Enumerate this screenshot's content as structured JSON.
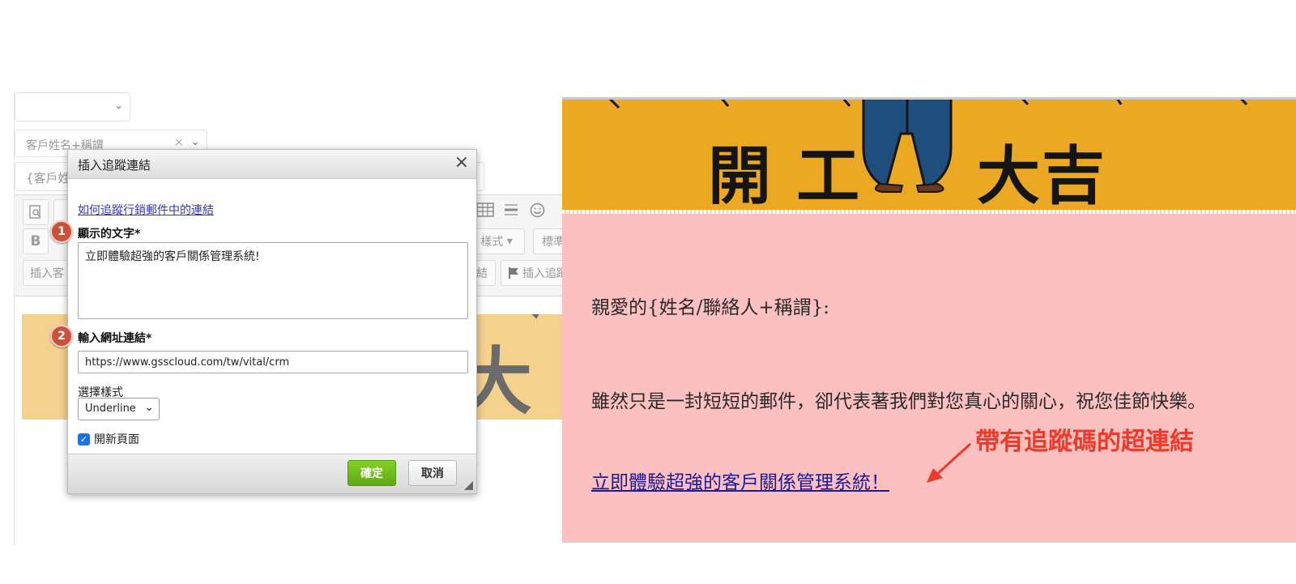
{
  "editor": {
    "salutation_select": "客戶姓名+稱謂",
    "salutation_clear": "×",
    "variable_field": "{客戶姓",
    "toolbar": {
      "style_button": "樣式",
      "format_button": "標準",
      "insert_customer_button": "插入客",
      "insert_link_button": "結",
      "insert_tracking_button": "插入追蹤"
    },
    "banner_ghost_text": "大吉"
  },
  "dialog": {
    "title": "插入追蹤連結",
    "close_label": "×",
    "help_link": "如何追蹤行銷郵件中的連結",
    "step1_badge": "1",
    "display_text_label": "顯示的文字*",
    "display_text_value": "立即體驗超強的客戶關係管理系統!",
    "step2_badge": "2",
    "url_label": "輸入網址連結*",
    "url_value": "https://www.gsscloud.com/tw/vital/crm",
    "style_label": "選擇樣式",
    "style_value": "Underline",
    "new_page_label": "開新頁面",
    "new_page_checked": true,
    "ok_button": "確定",
    "cancel_button": "取消"
  },
  "preview": {
    "banner_left": "開 工",
    "banner_right": "大吉",
    "greeting": "親愛的{姓名/聯絡人+稱謂}:",
    "body": "雖然只是一封短短的郵件，卻代表著我們對您真心的關心，祝您佳節快樂。",
    "link_text": "立即體驗超強的客戶關係管理系統！",
    "annotation": "帶有追蹤碼的超連結"
  },
  "colors": {
    "preview_bg": "#fdc0c0",
    "banner_bg": "#eaa823",
    "annotation_red": "#ee3a2a",
    "ok_green": "#6cb91a",
    "marker": "#c9533a"
  }
}
